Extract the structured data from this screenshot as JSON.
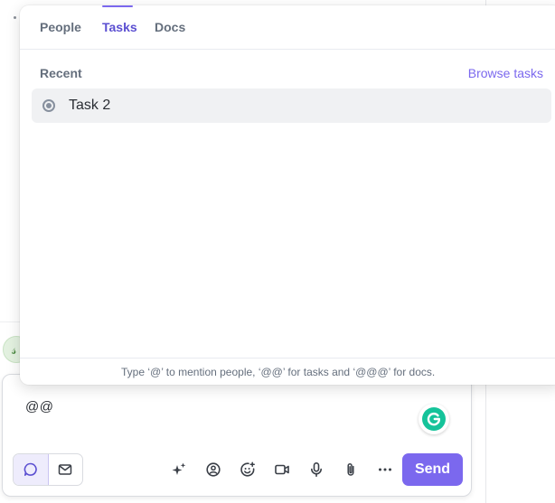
{
  "popup": {
    "tabs": [
      {
        "label": "People",
        "active": false
      },
      {
        "label": "Tasks",
        "active": true
      },
      {
        "label": "Docs",
        "active": false
      }
    ],
    "section_title": "Recent",
    "browse_label": "Browse tasks",
    "tasks": [
      {
        "name": "Task 2",
        "status": "in-progress"
      }
    ],
    "footer_hint": "Type ‘@’ to mention people, ‘@@’ for tasks and ‘@@@’ for docs."
  },
  "composer": {
    "text": "@@",
    "send_label": "Send",
    "toolbar_icons": [
      "ai-sparkle-icon",
      "mention-icon",
      "emoji-icon",
      "video-icon",
      "microphone-icon",
      "attachment-icon",
      "more-icon"
    ]
  },
  "colors": {
    "accent": "#7b68ee",
    "accent_text": "#5b4fd1",
    "grammarly": "#15c39a",
    "muted_text": "#656f7d"
  }
}
